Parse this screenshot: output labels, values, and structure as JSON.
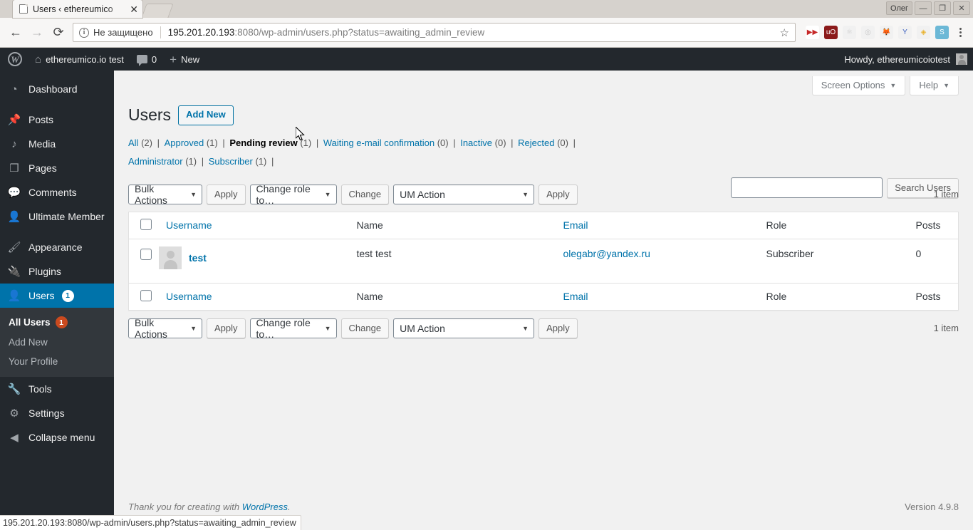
{
  "browser": {
    "tab": {
      "title": "Users ‹ ethereumico",
      "close_label": "✕",
      "icon": "page-icon"
    },
    "window_user": "Олег",
    "window_minimize": "—",
    "window_maximize": "❐",
    "window_close": "✕",
    "nav": {
      "back": "←",
      "forward": "→",
      "reload": "⟳"
    },
    "address": {
      "security_icon": "i",
      "security_label": "Не защищено",
      "url_host": "195.201.20.193",
      "url_rest": ":8080/wp-admin/users.php?status=awaiting_admin_review",
      "bookmark_icon": "☆"
    },
    "extensions": [
      {
        "name": "video-downloader-icon",
        "glyph": "▶▶",
        "color": "#c62828",
        "bg": "#ffffff"
      },
      {
        "name": "ublock-origin-icon",
        "glyph": "uO",
        "color": "#ffffff",
        "bg": "#8b1a1a"
      },
      {
        "name": "react-devtools-icon",
        "glyph": "⚛",
        "color": "#cfcfcf",
        "bg": "#f1f1f1"
      },
      {
        "name": "recorder-icon",
        "glyph": "◎",
        "color": "#c9c9c9",
        "bg": "#f1f1f1"
      },
      {
        "name": "fox-icon",
        "glyph": "🦊",
        "color": "#e8833a",
        "bg": "#f1f1f1"
      },
      {
        "name": "yandex-icon",
        "glyph": "Y",
        "color": "#3b5fc0",
        "bg": "#f1f1f1"
      },
      {
        "name": "diamond-icon",
        "glyph": "◈",
        "color": "#e8b12a",
        "bg": "#f1f1f1"
      },
      {
        "name": "grammar-icon",
        "glyph": "S",
        "color": "#ffffff",
        "bg": "#6cb8d6"
      }
    ],
    "menu_icon": "menu-dots",
    "statusbar_url": "195.201.20.193:8080/wp-admin/users.php?status=awaiting_admin_review"
  },
  "adminbar": {
    "logo": "W",
    "site_name": "ethereumico.io test",
    "home_icon": "⌂",
    "comments_count": "0",
    "new_label": "New",
    "plus": "+",
    "howdy": "Howdy, ethereumicoiotest"
  },
  "sidebar": {
    "items": [
      {
        "label": "Dashboard",
        "icon": "dashboard-icon",
        "glyph": "◔",
        "sep_after": true
      },
      {
        "label": "Posts",
        "icon": "pin-icon",
        "glyph": "📌"
      },
      {
        "label": "Media",
        "icon": "media-icon",
        "glyph": "♪"
      },
      {
        "label": "Pages",
        "icon": "pages-icon",
        "glyph": "❒"
      },
      {
        "label": "Comments",
        "icon": "comments-icon",
        "glyph": "💬"
      },
      {
        "label": "Ultimate Member",
        "icon": "user-icon",
        "glyph": "👤",
        "sep_after": true
      },
      {
        "label": "Appearance",
        "icon": "brush-icon",
        "glyph": "🖌"
      },
      {
        "label": "Plugins",
        "icon": "plug-icon",
        "glyph": "🔌"
      },
      {
        "label": "Users",
        "icon": "users-icon",
        "glyph": "👤",
        "current": true,
        "badge": "1"
      }
    ],
    "submenu": [
      {
        "label": "All Users",
        "current": true,
        "badge": "1"
      },
      {
        "label": "Add New"
      },
      {
        "label": "Your Profile"
      }
    ],
    "items_after": [
      {
        "label": "Tools",
        "icon": "wrench-icon",
        "glyph": "🔧"
      },
      {
        "label": "Settings",
        "icon": "settings-icon",
        "glyph": "⚙"
      },
      {
        "label": "Collapse menu",
        "icon": "collapse-icon",
        "glyph": "◀"
      }
    ]
  },
  "screen_meta": {
    "screen_options": "Screen Options",
    "help": "Help",
    "caret": "▼"
  },
  "page": {
    "title": "Users",
    "add_new": "Add New",
    "filters": [
      {
        "label": "All",
        "count": "(2)",
        "current": false
      },
      {
        "label": "Approved",
        "count": "(1)",
        "current": false
      },
      {
        "label": "Pending review",
        "count": "(1)",
        "current": true
      },
      {
        "label": "Waiting e-mail confirmation",
        "count": "(0)",
        "current": false
      },
      {
        "label": "Inactive",
        "count": "(0)",
        "current": false
      },
      {
        "label": "Rejected",
        "count": "(0)",
        "current": false
      },
      {
        "label": "Administrator",
        "count": "(1)",
        "current": false
      },
      {
        "label": "Subscriber",
        "count": "(1)",
        "current": false
      }
    ],
    "separator": "|"
  },
  "search": {
    "value": "",
    "placeholder": "",
    "button": "Search Users"
  },
  "tablenav": {
    "bulk_actions": "Bulk Actions",
    "apply": "Apply",
    "change_role": "Change role to…",
    "change": "Change",
    "um_action": "UM Action",
    "apply2": "Apply",
    "displaying_num": "1 item",
    "arrow": "▼"
  },
  "table": {
    "columns": {
      "username": "Username",
      "name": "Name",
      "email": "Email",
      "role": "Role",
      "posts": "Posts"
    },
    "rows": [
      {
        "username": "test",
        "name": "test test",
        "email": "olegabr@yandex.ru",
        "role": "Subscriber",
        "posts": "0"
      }
    ]
  },
  "footer": {
    "thanks_prefix": "Thank you for creating with ",
    "thanks_link": "WordPress",
    "thanks_suffix": ".",
    "version": "Version 4.9.8"
  }
}
